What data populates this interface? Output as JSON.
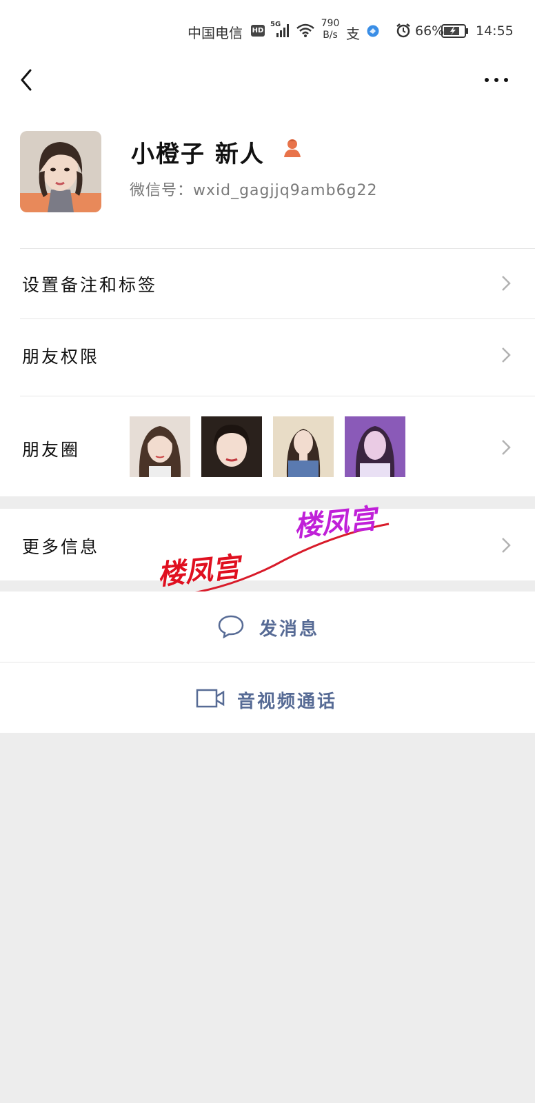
{
  "status_bar": {
    "carrier": "中国电信",
    "hd": "HD",
    "network": "5G",
    "speed_value": "790",
    "speed_unit": "B/s",
    "pay_icon": "支",
    "battery_percent": "66%",
    "time": "14:55"
  },
  "profile": {
    "name": "小橙子 新人",
    "wechat_id": "微信号：wxid_gagjjq9amb6g22",
    "gender_icon": "female-user-icon"
  },
  "menu": {
    "remark": "设置备注和标签",
    "permissions": "朋友权限",
    "moments": "朋友圈",
    "more_info": "更多信息"
  },
  "actions": {
    "message": "发消息",
    "call": "音视频通话"
  },
  "watermark": {
    "text1": "楼凤宫",
    "text2": "楼凤宫"
  },
  "colors": {
    "link": "#576b95",
    "gender": "#e8734a",
    "background": "#ededed"
  }
}
